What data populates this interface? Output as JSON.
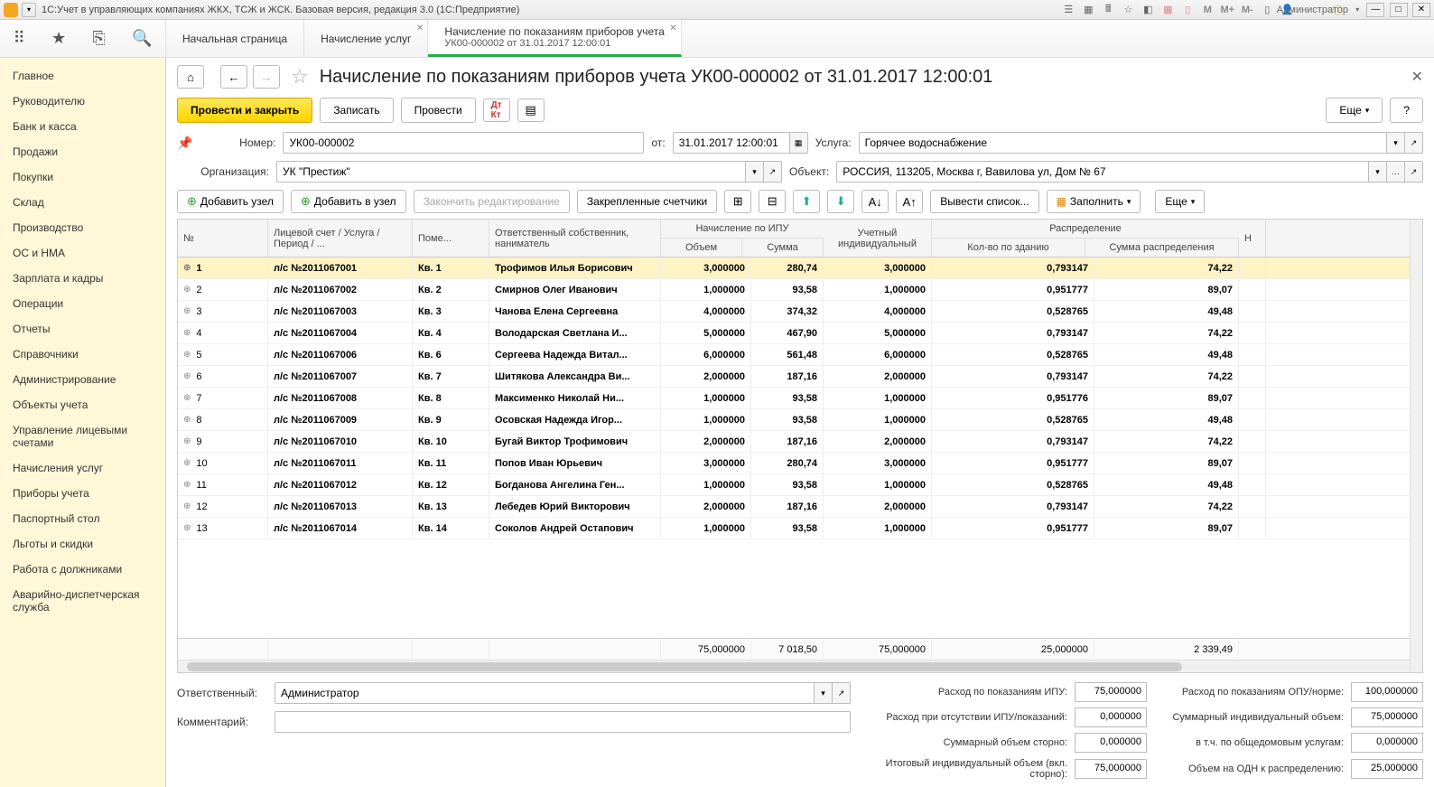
{
  "titlebar": {
    "title": "1С:Учет в управляющих компаниях ЖКХ, ТСЖ и ЖСК. Базовая версия, редакция 3.0  (1С:Предприятие)",
    "user": "Администратор"
  },
  "tabs": {
    "home": "Начальная страница",
    "t1": "Начисление услуг",
    "t2_line1": "Начисление по показаниям приборов учета",
    "t2_line2": "УК00-000002 от 31.01.2017 12:00:01"
  },
  "sidebar": {
    "items": [
      "Главное",
      "Руководителю",
      "Банк и касса",
      "Продажи",
      "Покупки",
      "Склад",
      "Производство",
      "ОС и НМА",
      "Зарплата и кадры",
      "Операции",
      "Отчеты",
      "Справочники",
      "Администрирование",
      "Объекты учета",
      "Управление лицевыми счетами",
      "Начисления услуг",
      "Приборы учета",
      "Паспортный стол",
      "Льготы и скидки",
      "Работа с должниками",
      "Аварийно-диспетчерская служба"
    ]
  },
  "header": {
    "title": "Начисление по показаниям приборов учета УК00-000002 от 31.01.2017 12:00:01"
  },
  "buttons": {
    "run_close": "Провести и закрыть",
    "save": "Записать",
    "run": "Провести",
    "more": "Еще",
    "help": "?"
  },
  "form": {
    "number_label": "Номер:",
    "number": "УК00-000002",
    "from_label": "от:",
    "from": "31.01.2017 12:00:01",
    "service_label": "Услуга:",
    "service": "Горячее водоснабжение",
    "org_label": "Организация:",
    "org": "УК \"Престиж\"",
    "object_label": "Объект:",
    "object": "РОССИЯ, 113205, Москва г, Вавилова ул, Дом № 67",
    "resp_label": "Ответственный:",
    "resp": "Администратор",
    "comment_label": "Комментарий:",
    "comment": ""
  },
  "toolbar": {
    "add_node": "Добавить узел",
    "add_in_node": "Добавить в узел",
    "end_edit": "Закончить редактирование",
    "fixed_meters": "Закрепленные счетчики",
    "output_list": "Вывести список...",
    "fill": "Заполнить",
    "more": "Еще"
  },
  "grid": {
    "headers": {
      "no": "№",
      "account": "Лицевой счет / Услуга / Период / ...",
      "room": "Поме...",
      "owner": "Ответственный собственник, наниматель",
      "ipu_group": "Начисление по ИПУ",
      "volume": "Объем",
      "sum": "Сумма",
      "uchet": "Учетный индивидуальный",
      "dist_group": "Распределение",
      "kolvo": "Кол-во по зданию",
      "sumr": "Сумма распределения",
      "h": "Н"
    },
    "rows": [
      {
        "no": "1",
        "acc": "л/с №2011067001",
        "room": "Кв. 1",
        "owner": "Трофимов Илья Борисович",
        "vol": "3,000000",
        "sum": "280,74",
        "uchet": "3,000000",
        "kolvo": "0,793147",
        "sumr": "74,22",
        "sel": true
      },
      {
        "no": "2",
        "acc": "л/с №2011067002",
        "room": "Кв. 2",
        "owner": "Смирнов Олег Иванович",
        "vol": "1,000000",
        "sum": "93,58",
        "uchet": "1,000000",
        "kolvo": "0,951777",
        "sumr": "89,07"
      },
      {
        "no": "3",
        "acc": "л/с №2011067003",
        "room": "Кв. 3",
        "owner": "Чанова Елена Сергеевна",
        "vol": "4,000000",
        "sum": "374,32",
        "uchet": "4,000000",
        "kolvo": "0,528765",
        "sumr": "49,48"
      },
      {
        "no": "4",
        "acc": "л/с №2011067004",
        "room": "Кв. 4",
        "owner": "Володарская Светлана И...",
        "vol": "5,000000",
        "sum": "467,90",
        "uchet": "5,000000",
        "kolvo": "0,793147",
        "sumr": "74,22"
      },
      {
        "no": "5",
        "acc": "л/с №2011067006",
        "room": "Кв. 6",
        "owner": "Сергеева Надежда Витал...",
        "vol": "6,000000",
        "sum": "561,48",
        "uchet": "6,000000",
        "kolvo": "0,528765",
        "sumr": "49,48"
      },
      {
        "no": "6",
        "acc": "л/с №2011067007",
        "room": "Кв. 7",
        "owner": "Шитякова Александра Ви...",
        "vol": "2,000000",
        "sum": "187,16",
        "uchet": "2,000000",
        "kolvo": "0,793147",
        "sumr": "74,22"
      },
      {
        "no": "7",
        "acc": "л/с №2011067008",
        "room": "Кв. 8",
        "owner": "Максименко Николай Ни...",
        "vol": "1,000000",
        "sum": "93,58",
        "uchet": "1,000000",
        "kolvo": "0,951776",
        "sumr": "89,07"
      },
      {
        "no": "8",
        "acc": "л/с №2011067009",
        "room": "Кв. 9",
        "owner": "Осовская Надежда Игор...",
        "vol": "1,000000",
        "sum": "93,58",
        "uchet": "1,000000",
        "kolvo": "0,528765",
        "sumr": "49,48"
      },
      {
        "no": "9",
        "acc": "л/с №2011067010",
        "room": "Кв. 10",
        "owner": "Бугай Виктор Трофимович",
        "vol": "2,000000",
        "sum": "187,16",
        "uchet": "2,000000",
        "kolvo": "0,793147",
        "sumr": "74,22"
      },
      {
        "no": "10",
        "acc": "л/с №2011067011",
        "room": "Кв. 11",
        "owner": "Попов Иван Юрьевич",
        "vol": "3,000000",
        "sum": "280,74",
        "uchet": "3,000000",
        "kolvo": "0,951777",
        "sumr": "89,07"
      },
      {
        "no": "11",
        "acc": "л/с №2011067012",
        "room": "Кв. 12",
        "owner": "Богданова Ангелина Ген...",
        "vol": "1,000000",
        "sum": "93,58",
        "uchet": "1,000000",
        "kolvo": "0,528765",
        "sumr": "49,48"
      },
      {
        "no": "12",
        "acc": "л/с №2011067013",
        "room": "Кв. 13",
        "owner": "Лебедев Юрий Викторович",
        "vol": "2,000000",
        "sum": "187,16",
        "uchet": "2,000000",
        "kolvo": "0,793147",
        "sumr": "74,22"
      },
      {
        "no": "13",
        "acc": "л/с №2011067014",
        "room": "Кв. 14",
        "owner": "Соколов Андрей Остапович",
        "vol": "1,000000",
        "sum": "93,58",
        "uchet": "1,000000",
        "kolvo": "0,951777",
        "sumr": "89,07"
      }
    ],
    "totals": {
      "vol": "75,000000",
      "sum": "7 018,50",
      "uchet": "75,000000",
      "kolvo": "25,000000",
      "sumr": "2 339,49"
    }
  },
  "stats": {
    "r1a_label": "Расход по показаниям ИПУ:",
    "r1a_val": "75,000000",
    "r1b_label": "Расход по показаниям ОПУ/норме:",
    "r1b_val": "100,000000",
    "r2a_label": "Расход при отсутствии ИПУ/показаний:",
    "r2a_val": "0,000000",
    "r2b_label": "Суммарный индивидуальный объем:",
    "r2b_val": "75,000000",
    "r3a_label": "Суммарный объем сторно:",
    "r3a_val": "0,000000",
    "r3b_label": "в т.ч. по общедомовым услугам:",
    "r3b_val": "0,000000",
    "r4a_label": "Итоговый индивидуальный объем (вкл. сторно):",
    "r4a_val": "75,000000",
    "r4b_label": "Объем на ОДН к распределению:",
    "r4b_val": "25,000000"
  }
}
